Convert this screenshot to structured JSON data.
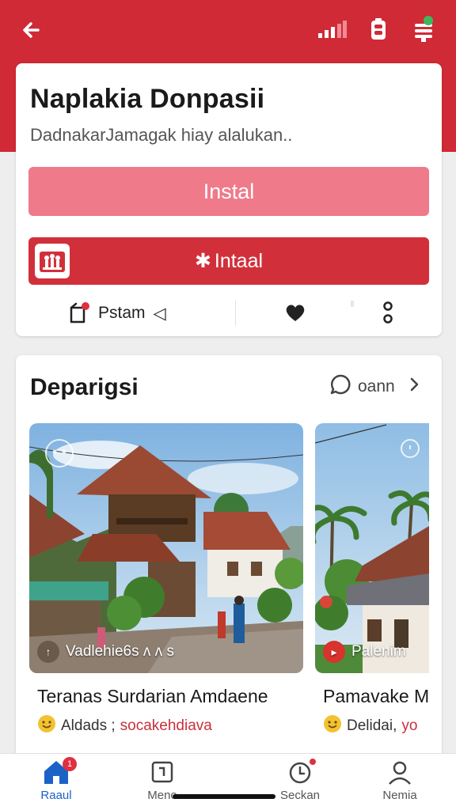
{
  "colors": {
    "brand_red": "#cf2a36",
    "install_light": "#ef7a8a",
    "install_dark": "#d1303b",
    "nav_active": "#1a62c7"
  },
  "status": {
    "icons": [
      "back-arrow-icon",
      "signal-icon",
      "battery-icon",
      "stack-icon"
    ]
  },
  "app": {
    "title": "Naplakia Donpasii",
    "subtitle": "DadnakarJamagak hiay alalukan..",
    "install_button": "Instal",
    "install_button_2": "Intaal",
    "install_button_2_icon": "✱",
    "post_label": "Pstam",
    "post_arrow": "◁"
  },
  "discover": {
    "title": "Deparigsi",
    "see_all": "oann",
    "items": [
      {
        "tag": "Vadlehie6s ᴧ ᴧ s",
        "tag_badge": "↑",
        "name": "Teranas Surdarian Amdaene",
        "meta_grey": "Aldads ;",
        "meta_red": "socakehdiava",
        "meta_icon": "smiley-icon"
      },
      {
        "tag": "Palenim",
        "tag_badge": "▸",
        "name": "Pamavake M",
        "meta_grey": "Delidai,",
        "meta_red": "yo",
        "meta_icon": "smiley-icon"
      }
    ]
  },
  "nav": {
    "items": [
      {
        "label": "Raaul",
        "icon": "home-icon",
        "active": true,
        "badge": "1"
      },
      {
        "label": "Meno",
        "icon": "calendar-icon",
        "active": false
      },
      {
        "label": "Seckan",
        "icon": "clock-icon",
        "active": false
      },
      {
        "label": "Nemia",
        "icon": "person-icon",
        "active": false
      }
    ]
  }
}
